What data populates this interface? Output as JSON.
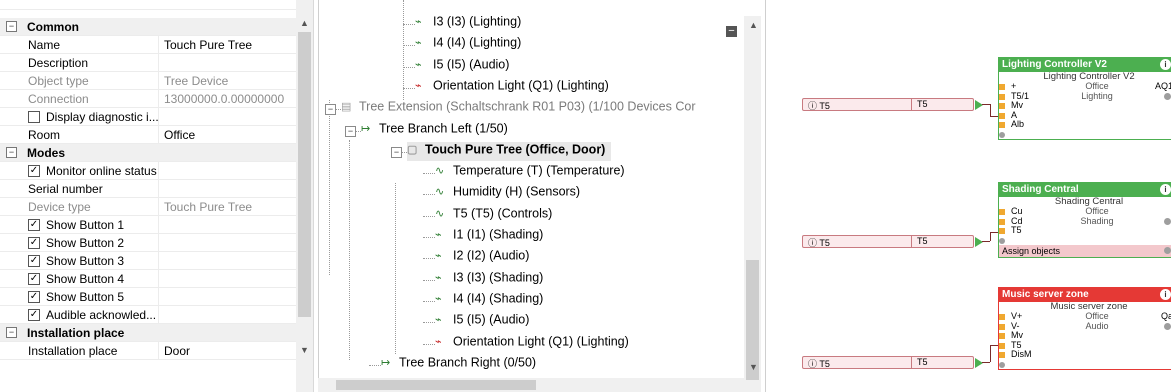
{
  "props": {
    "rows": [
      {
        "type": "cat",
        "name": "Common"
      },
      {
        "type": "row",
        "name": "Name",
        "value": "Touch Pure Tree"
      },
      {
        "type": "row",
        "name": "Description",
        "value": ""
      },
      {
        "type": "ro",
        "name": "Object type",
        "value": "Tree Device"
      },
      {
        "type": "ro",
        "name": "Connection",
        "value": "13000000.0.00000000"
      },
      {
        "type": "cb",
        "name": "Display diagnostic i...",
        "checked": false
      },
      {
        "type": "row",
        "name": "Room",
        "value": "Office"
      },
      {
        "type": "cat",
        "name": "Modes"
      },
      {
        "type": "cb",
        "name": "Monitor online status",
        "checked": true
      },
      {
        "type": "row",
        "name": "Serial number",
        "value": ""
      },
      {
        "type": "ro",
        "name": "Device type",
        "value": "Touch Pure Tree"
      },
      {
        "type": "cb",
        "name": "Show Button 1",
        "checked": true
      },
      {
        "type": "cb",
        "name": "Show Button 2",
        "checked": true
      },
      {
        "type": "cb",
        "name": "Show Button 3",
        "checked": true
      },
      {
        "type": "cb",
        "name": "Show Button 4",
        "checked": true
      },
      {
        "type": "cb",
        "name": "Show Button 5",
        "checked": true
      },
      {
        "type": "cb",
        "name": "Audible acknowled...",
        "checked": true
      },
      {
        "type": "cat",
        "name": "Installation place"
      },
      {
        "type": "row",
        "name": "Installation place",
        "value": "Door"
      }
    ],
    "collapse_symbol": "⊟",
    "check_symbol": "✓"
  },
  "tree": {
    "nodes": [
      {
        "label": "I3 (I3) (Lighting)",
        "icon": "input-icon",
        "style": "normal"
      },
      {
        "label": "I4 (I4) (Lighting)",
        "icon": "input-icon",
        "style": "normal"
      },
      {
        "label": "I5 (I5) (Audio)",
        "icon": "input-icon",
        "style": "normal"
      },
      {
        "label": "Orientation Light (Q1) (Lighting)",
        "icon": "output-icon",
        "style": "normal"
      },
      {
        "label": "Tree Extension (Schaltschrank R01 P03) (1/100 Devices Cor",
        "icon": "extension-icon",
        "style": "grey"
      },
      {
        "label": "Tree Branch Left (1/50)",
        "icon": "branch-icon",
        "style": "normal"
      },
      {
        "label": "Touch Pure Tree (Office, Door)",
        "icon": "device-icon",
        "style": "bold"
      },
      {
        "label": "Temperature (T) (Temperature)",
        "icon": "analog-input-icon",
        "style": "normal"
      },
      {
        "label": "Humidity (H) (Sensors)",
        "icon": "analog-input-icon",
        "style": "normal"
      },
      {
        "label": "T5 (T5) (Controls)",
        "icon": "analog-input-icon",
        "style": "normal"
      },
      {
        "label": "I1 (I1) (Shading)",
        "icon": "input-icon",
        "style": "normal"
      },
      {
        "label": "I2 (I2) (Audio)",
        "icon": "input-icon",
        "style": "normal"
      },
      {
        "label": "I3 (I3) (Shading)",
        "icon": "input-icon",
        "style": "normal"
      },
      {
        "label": "I4 (I4) (Shading)",
        "icon": "input-icon",
        "style": "normal"
      },
      {
        "label": "I5 (I5) (Audio)",
        "icon": "input-icon",
        "style": "normal"
      },
      {
        "label": "Orientation Light (Q1) (Lighting)",
        "icon": "output-icon",
        "style": "normal"
      },
      {
        "label": "Tree Branch Right (0/50)",
        "icon": "branch-icon",
        "style": "normal"
      }
    ],
    "collapse_symbol": "−"
  },
  "canvas": {
    "inputs": [
      {
        "label": "T5",
        "value": "T5"
      },
      {
        "label": "T5",
        "value": "T5"
      },
      {
        "label": "T5",
        "value": "T5"
      }
    ],
    "blocks": [
      {
        "title": "Lighting Controller V2",
        "color": "#4caf50",
        "subtitle": "Lighting Controller V2",
        "ports": [
          {
            "name": "+",
            "mid": "Office",
            "right": "AQ1"
          },
          {
            "name": "T5/1",
            "mid": "Lighting",
            "right": ""
          },
          {
            "name": "Mv",
            "mid": "",
            "right": ""
          },
          {
            "name": "A",
            "mid": "",
            "right": ""
          },
          {
            "name": "Alb",
            "mid": "",
            "right": ""
          }
        ],
        "assign": ""
      },
      {
        "title": "Shading Central",
        "color": "#4caf50",
        "subtitle": "Shading Central",
        "ports": [
          {
            "name": "Cu",
            "mid": "Office",
            "right": ""
          },
          {
            "name": "Cd",
            "mid": "Shading",
            "right": ""
          },
          {
            "name": "T5",
            "mid": "",
            "right": ""
          }
        ],
        "assign": "Assign objects"
      },
      {
        "title": "Music server zone",
        "color": "#e53935",
        "subtitle": "Music server zone",
        "ports": [
          {
            "name": "V+",
            "mid": "Office",
            "right": "Qa"
          },
          {
            "name": "V-",
            "mid": "Audio",
            "right": ""
          },
          {
            "name": "Mv",
            "mid": "",
            "right": ""
          },
          {
            "name": "T5",
            "mid": "",
            "right": ""
          },
          {
            "name": "DisM",
            "mid": "",
            "right": ""
          }
        ],
        "assign": ""
      }
    ],
    "info_symbol": "i"
  }
}
